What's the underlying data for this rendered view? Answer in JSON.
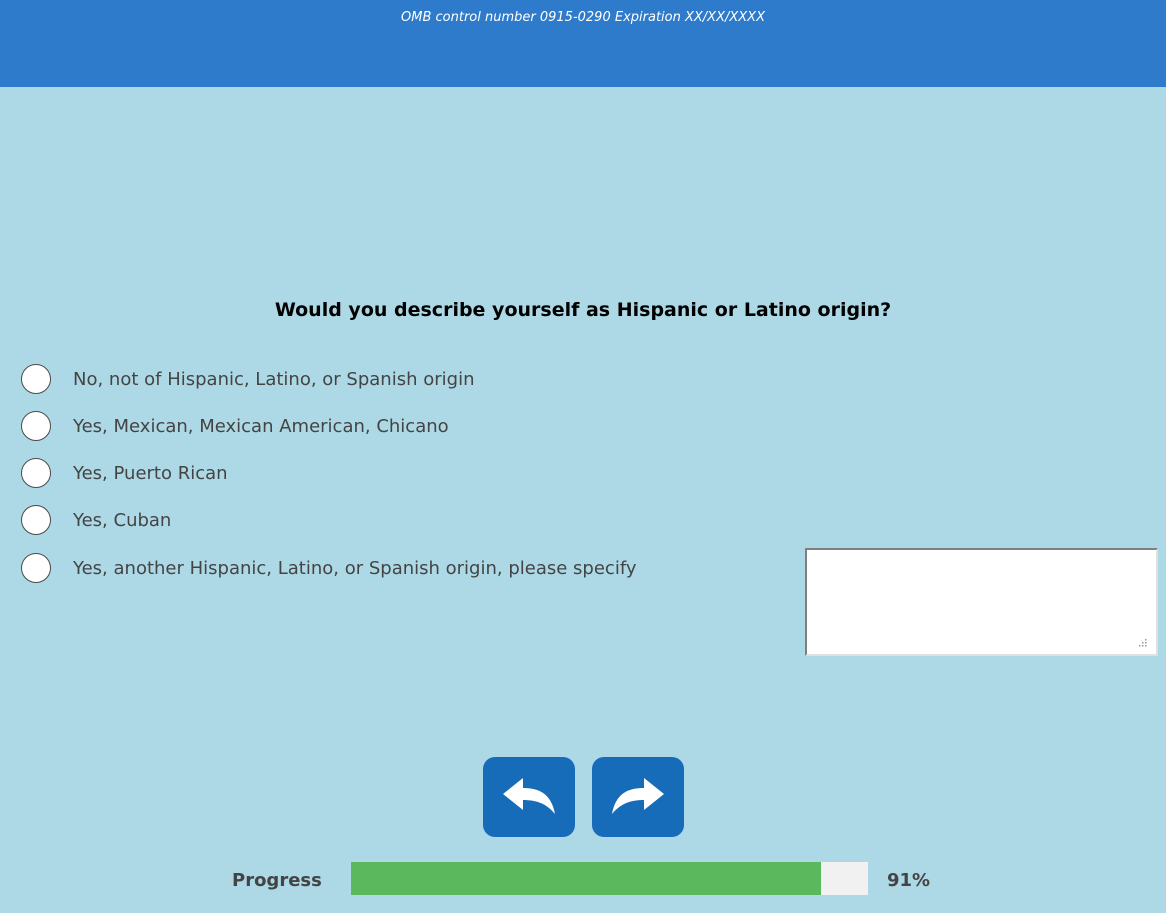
{
  "header": {
    "omb_text": "OMB control number 0915-0290 Expiration XX/XX/XXXX",
    "color": "#2f7bcb"
  },
  "background_color": "#add8e6",
  "question": {
    "text": "Would you describe yourself as Hispanic or Latino origin?"
  },
  "options": [
    {
      "label": "No, not of Hispanic, Latino, or Spanish origin",
      "selected": false
    },
    {
      "label": "Yes, Mexican, Mexican American, Chicano",
      "selected": false
    },
    {
      "label": "Yes, Puerto Rican",
      "selected": false
    },
    {
      "label": "Yes, Cuban",
      "selected": false
    },
    {
      "label": "Yes, another Hispanic, Latino, or Spanish origin, please specify",
      "selected": false
    }
  ],
  "specify_input": {
    "value": ""
  },
  "navigation": {
    "back_icon": "undo-arrow-icon",
    "next_icon": "redo-arrow-icon",
    "button_color": "#176cba"
  },
  "progress": {
    "label": "Progress",
    "value": 0.91,
    "percent_text": "91%",
    "fill_color": "#5cb85c"
  }
}
